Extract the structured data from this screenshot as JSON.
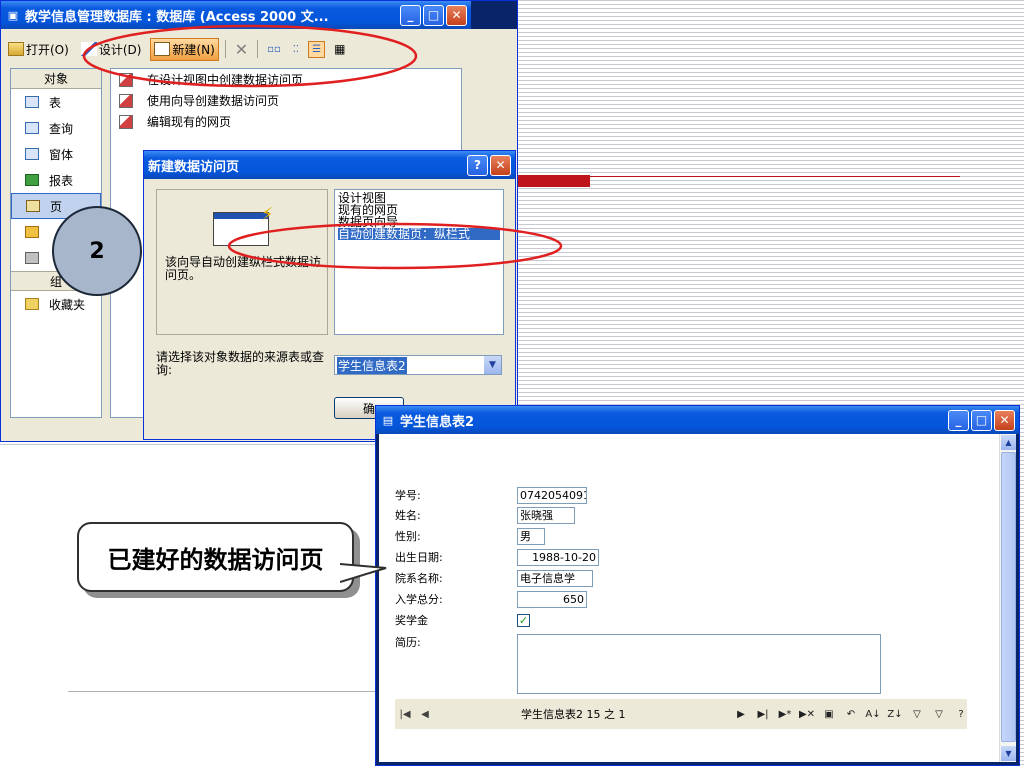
{
  "db_window": {
    "title": "教学信息管理数据库 : 数据库 (Access 2000 文...",
    "toolbar": {
      "open_label": "打开(O)",
      "design_label": "设计(D)",
      "new_label": "新建(N)"
    },
    "objects_header": "对象",
    "objects": [
      "表",
      "查询",
      "窗体",
      "报表",
      "页",
      "宏",
      "模块"
    ],
    "groups_header": "组",
    "favorites_label": "收藏夹",
    "list_items": [
      "在设计视图中创建数据访问页",
      "使用向导创建数据访问页",
      "编辑现有的网页"
    ]
  },
  "new_dialog": {
    "title": "新建数据访问页",
    "description": "该向导自动创建纵栏式数据访问页。",
    "options": [
      "设计视图",
      "现有的网页",
      "数据页向导",
      "自动创建数据页：纵栏式"
    ],
    "selected_option": "自动创建数据页：纵栏式",
    "source_label": "请选择该对象数据的来源表或查询:",
    "source_value": "学生信息表2",
    "ok_label": "确"
  },
  "form_window": {
    "title": "学生信息表2",
    "fields": [
      {
        "label": "学号:",
        "value": "0742054091"
      },
      {
        "label": "姓名:",
        "value": "张晓强"
      },
      {
        "label": "性别:",
        "value": "男"
      },
      {
        "label": "出生日期:",
        "value": "1988-10-20"
      },
      {
        "label": "院系名称:",
        "value": "电子信息学"
      },
      {
        "label": "入学总分:",
        "value": "650"
      }
    ],
    "scholarship_label": "奖学金",
    "scholarship_checked": true,
    "resume_label": "简历:",
    "nav_record_text": "学生信息表2 15 之 1"
  },
  "annotations": {
    "step_number": "2",
    "callout_text": "已建好的数据访问页"
  },
  "colors": {
    "xp_title_blue": "#0455d9",
    "highlight_red": "#e02020",
    "selection_blue": "#316ac5"
  }
}
